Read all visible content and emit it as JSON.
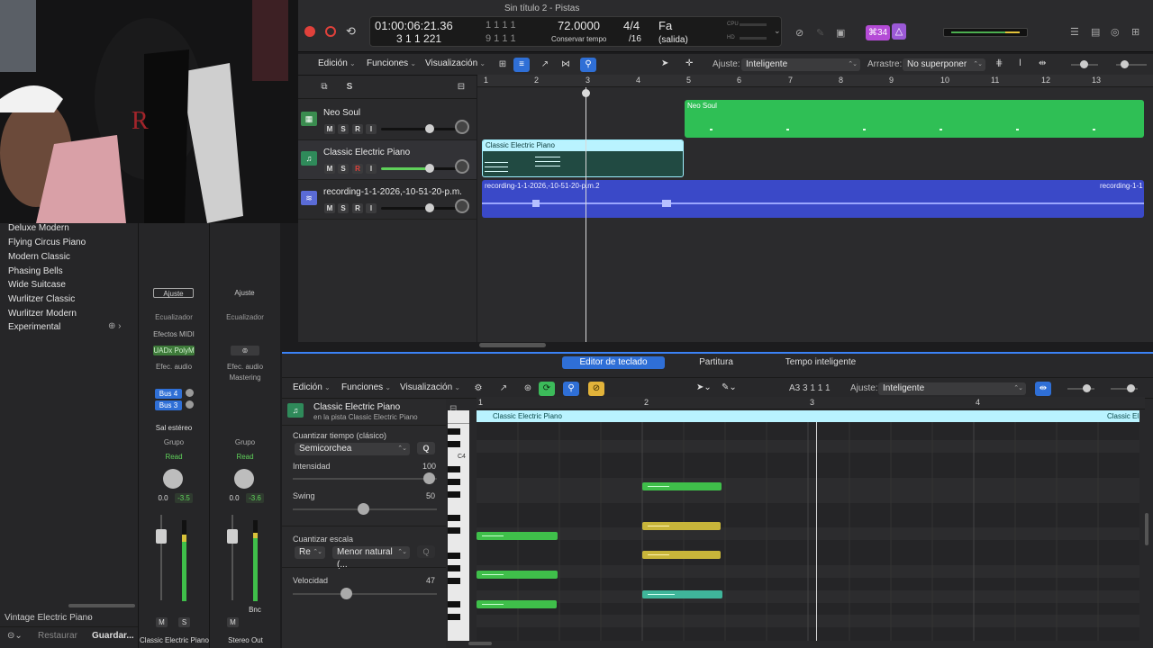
{
  "window": {
    "title": "Sin título 2 - Pistas"
  },
  "lcd": {
    "time": "01:00:06:21.36",
    "bars": "3  1  1  221",
    "sub1": "1  1  1     1",
    "sub2": "9  1  1     1",
    "tempo": "72.0000",
    "tempo_label": "Conservar tempo",
    "sig": "4/4",
    "div": "/16",
    "key": "Fa",
    "key_sub": "(salida)",
    "cpu": "CPU",
    "hd": "HD"
  },
  "badge": "⌘34",
  "main_toolbar": {
    "edit": "Edición",
    "functions": "Funciones",
    "view": "Visualización",
    "snap_label": "Ajuste:",
    "snap_value": "Inteligente",
    "drag_label": "Arrastre:",
    "drag_value": "No superponer"
  },
  "tracks_header": {
    "s_button": "S"
  },
  "tracks": [
    {
      "name": "Neo Soul",
      "m": "M",
      "s": "S",
      "r": "R",
      "i": "I"
    },
    {
      "name": "Classic Electric Piano",
      "m": "M",
      "s": "S",
      "r": "R",
      "i": "I"
    },
    {
      "name": "recording-1-1-2026,-10-51-20-p.m.",
      "m": "M",
      "s": "S",
      "r": "R",
      "i": "I"
    }
  ],
  "ruler": [
    "1",
    "2",
    "3",
    "4",
    "5",
    "6",
    "7",
    "8",
    "9",
    "10",
    "11",
    "12",
    "13"
  ],
  "regions": {
    "neo_soul": "Neo Soul",
    "classic": "Classic Electric Piano",
    "audio": "recording-1-1-2026,-10-51-20-p.m.2",
    "audio2": "recording-1-1"
  },
  "sidebar": {
    "items": [
      "Deluxe Modern",
      "Flying Circus Piano",
      "Modern Classic",
      "Phasing Bells",
      "Wide Suitcase",
      "Wurlitzer Classic",
      "Wurlitzer Modern",
      "Experimental"
    ],
    "footer_path": "Vintage Electric Piano",
    "restore": "Restaurar",
    "save": "Guardar..."
  },
  "mixer": {
    "strip1": {
      "setting": "Ajuste",
      "eq": "Ecualizador",
      "midi": "Efectos MIDI",
      "plugin": "UADx PolyM",
      "audio_fx": "Efec. audio",
      "send1": "Bus 4",
      "send2": "Bus 3",
      "output": "Sal estéreo",
      "group": "Grupo",
      "auto": "Read",
      "pan_l": "0.0",
      "pan_r": "-3.5",
      "m": "M",
      "s": "S",
      "name": "Classic Electric Piano"
    },
    "strip2": {
      "setting": "Ajuste",
      "eq": "Ecualizador",
      "audio_fx": "Efec. audio",
      "fx_name": "Mastering",
      "group": "Grupo",
      "auto": "Read",
      "pan_l": "0.0",
      "pan_r": "-3.6",
      "m": "M",
      "bnc": "Bnc",
      "name": "Stereo Out"
    }
  },
  "editor_tabs": [
    "Editor de teclado",
    "Partitura",
    "Tempo inteligente"
  ],
  "editor_toolbar": {
    "edit": "Edición",
    "functions": "Funciones",
    "view": "Visualización",
    "position": "A3   3 1 1 1",
    "snap_label": "Ajuste:",
    "snap_value": "Inteligente"
  },
  "inspector": {
    "region_name": "Classic Electric Piano",
    "region_sub": "en la pista Classic Electric Piano",
    "quant_time_label": "Cuantizar tiempo (clásico)",
    "quant_value": "Semicorchea",
    "q": "Q",
    "intensity_label": "Intensidad",
    "intensity_value": "100",
    "swing_label": "Swing",
    "swing_value": "50",
    "scale_label": "Cuantizar escala",
    "scale_root": "Re",
    "scale_type": "Menor natural (...",
    "velocity_label": "Velocidad",
    "velocity_value": "47"
  },
  "piano_roll": {
    "ruler": [
      "1",
      "2",
      "3",
      "4"
    ],
    "region_name": "Classic Electric Piano",
    "region_name_2": "Classic El",
    "c4": "C4"
  }
}
